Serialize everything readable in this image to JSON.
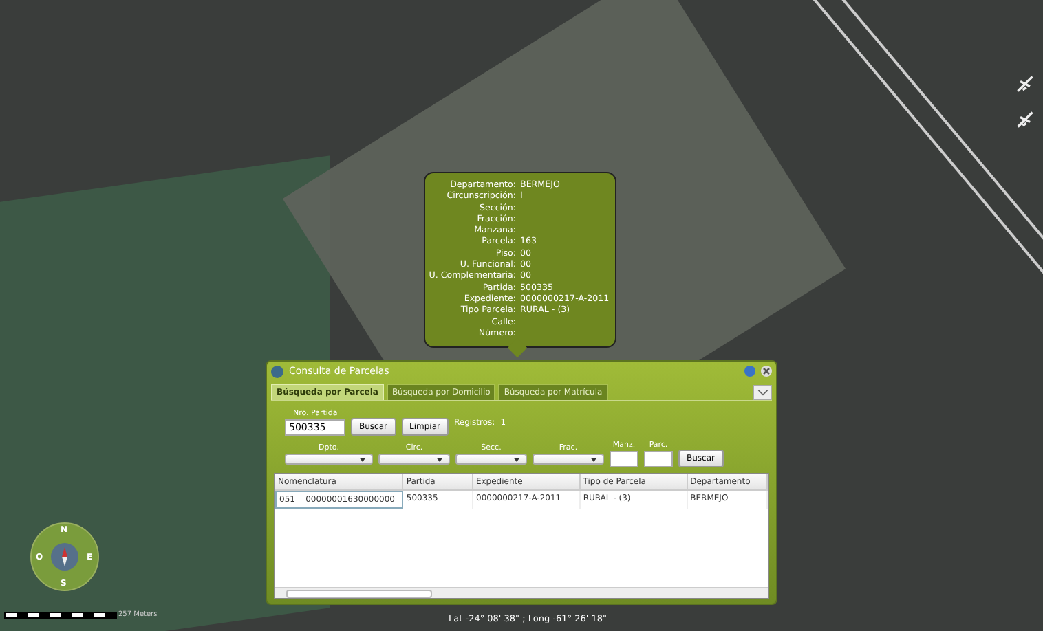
{
  "map": {
    "compass": [
      "N",
      "O",
      "E",
      "S"
    ],
    "scale_label": "257 Meters",
    "coordinates": "Lat -24° 08' 38\" ; Long -61° 26' 18\""
  },
  "popup": {
    "fields": [
      {
        "label": "Departamento:",
        "value": "BERMEJO"
      },
      {
        "label": "Circunscripción:",
        "value": "I"
      },
      {
        "label": "Sección:"
      },
      {
        "label": "Fracción:"
      },
      {
        "label": "Manzana:"
      },
      {
        "label": "Parcela:",
        "value": "163"
      },
      {
        "label": "Piso:",
        "value": "00"
      },
      {
        "label": "U. Funcional:",
        "value": "00"
      },
      {
        "label": "U. Complementaria:",
        "value": "00"
      },
      {
        "label": "Partida:",
        "value": "500335"
      },
      {
        "label": "Expediente:",
        "value": "0000000217-A-2011"
      },
      {
        "label": "Tipo Parcela:",
        "value": "RURAL - (3)"
      },
      {
        "label": "Calle:"
      },
      {
        "label": "Número:"
      }
    ]
  },
  "window": {
    "title": "Consulta de Parcelas",
    "tabs": [
      {
        "label": "Búsqueda por Parcela",
        "selected": true
      },
      {
        "label": "Búsqueda por Domicilio",
        "selected": false
      },
      {
        "label": "Búsqueda por Matrícula",
        "selected": false
      }
    ],
    "search": {
      "label": "Nro. Partida",
      "value": "500335",
      "buttons": [
        "Buscar",
        "Limpiar"
      ],
      "registros_label": "Registros:",
      "registros_value": "1"
    },
    "filters": [
      {
        "label": "Dpto.",
        "kind": "dropdown"
      },
      {
        "label": "Circ.",
        "kind": "dropdown"
      },
      {
        "label": "Secc.",
        "kind": "dropdown"
      },
      {
        "label": "Frac.",
        "kind": "dropdown"
      },
      {
        "label": "Manz.",
        "kind": "text"
      },
      {
        "label": "Parc.",
        "kind": "text"
      }
    ],
    "filter_button": "Buscar",
    "table": {
      "columns": [
        "Nomenclatura",
        "Partida",
        "Expediente",
        "Tipo de Parcela",
        "Departamento"
      ],
      "rows": [
        {
          "cells": [
            "051    00000001630000000",
            "500335",
            "0000000217-A-2011",
            "RURAL - (3)",
            "BERMEJO"
          ]
        }
      ]
    }
  }
}
